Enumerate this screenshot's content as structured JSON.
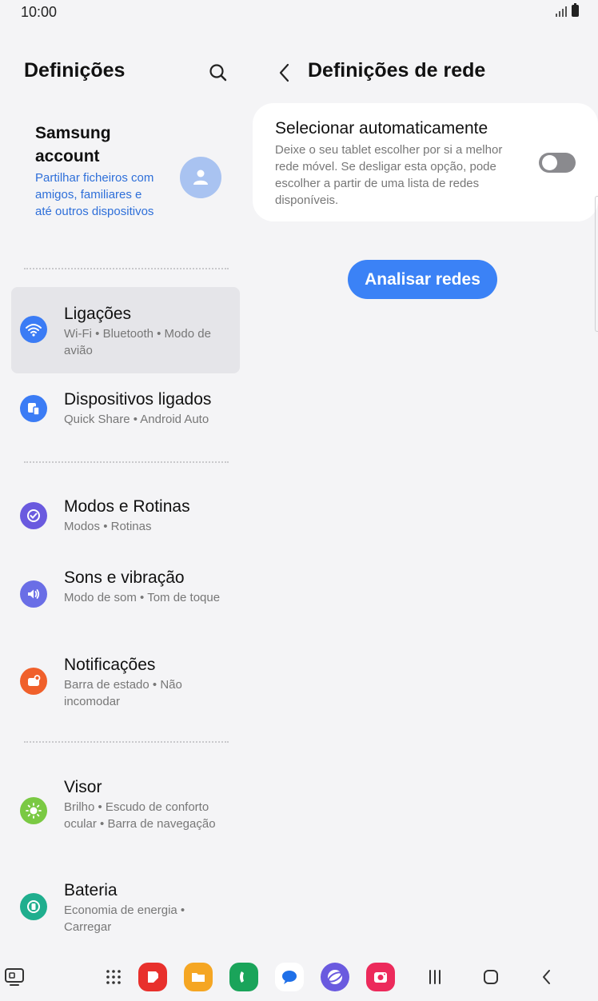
{
  "status_bar": {
    "time": "10:00"
  },
  "left": {
    "title": "Definições",
    "account": {
      "title": "Samsung account",
      "subtitle": "Partilhar ficheiros com amigos, familiares e até outros dispositivos"
    },
    "items": [
      {
        "title": "Ligações",
        "subtitle": "Wi-Fi • Bluetooth • Modo de avião",
        "icon": "wifi-icon",
        "color": "#3b7cf5"
      },
      {
        "title": "Dispositivos ligados",
        "subtitle": "Quick Share • Android Auto",
        "icon": "connected-devices-icon",
        "color": "#3b7cf5"
      },
      {
        "title": "Modos e Rotinas",
        "subtitle": "Modos • Rotinas",
        "icon": "modes-check-icon",
        "color": "#6a5adf"
      },
      {
        "title": "Sons e vibração",
        "subtitle": "Modo de som • Tom de toque",
        "icon": "speaker-icon",
        "color": "#6a6ee6"
      },
      {
        "title": "Notificações",
        "subtitle": "Barra de estado • Não incomodar",
        "icon": "notification-icon",
        "color": "#f0602b"
      },
      {
        "title": "Visor",
        "subtitle": "Brilho • Escudo de conforto ocular • Barra de navegação",
        "icon": "sun-icon",
        "color": "#7ac943"
      },
      {
        "title": "Bateria",
        "subtitle": "Economia de energia • Carregar",
        "icon": "battery-icon",
        "color": "#1fae8e"
      }
    ]
  },
  "right": {
    "title": "Definições de rede",
    "auto_select": {
      "title": "Selecionar automaticamente",
      "description": "Deixe o seu tablet escolher por si a melhor rede móvel. Se desligar esta opção, pode escolher a partir de uma lista de redes disponíveis.",
      "enabled": false
    },
    "scan_button": "Analisar redes"
  },
  "taskbar": {
    "apps": [
      {
        "name": "app-drawer-icon"
      },
      {
        "name": "samsung-notes-icon",
        "color": "#e8302c"
      },
      {
        "name": "my-files-icon",
        "color": "#f5a623"
      },
      {
        "name": "phone-icon",
        "color": "#1aa45a"
      },
      {
        "name": "messages-icon",
        "color": "#ffffff"
      },
      {
        "name": "internet-icon",
        "color": "#6a5adf"
      },
      {
        "name": "camera-icon",
        "color": "#ec2a5b"
      }
    ]
  }
}
